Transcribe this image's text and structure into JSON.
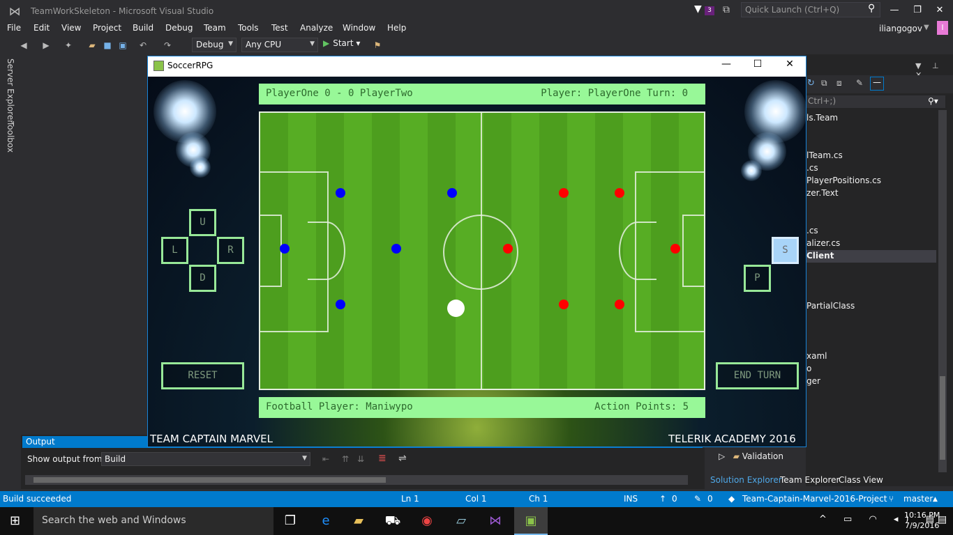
{
  "window": {
    "title": "TeamWorkSkeleton - Microsoft Visual Studio",
    "notification_count": "3",
    "quick_launch_placeholder": "Quick Launch (Ctrl+Q)",
    "username": "iliangogov",
    "user_initial": "I"
  },
  "menu": [
    "File",
    "Edit",
    "View",
    "Project",
    "Build",
    "Debug",
    "Team",
    "Tools",
    "Test",
    "Analyze",
    "Window",
    "Help"
  ],
  "toolbar": {
    "config": "Debug",
    "platform": "Any CPU",
    "start_label": "Start"
  },
  "left_tabs": [
    "Server Explorer",
    "Toolbox"
  ],
  "solution_explorer": {
    "search_placeholder": "Ctrl+;)",
    "items": [
      "ls.Team",
      "lTeam.cs",
      ".cs",
      "PlayerPositions.cs",
      "zer.Text",
      ".cs",
      "alizer.cs",
      "Client",
      "PartialClass",
      "xaml",
      "o",
      "ger"
    ],
    "selected": "Client",
    "validation": "Validation",
    "tabs": [
      "Solution Explorer",
      "Team Explorer",
      "Class View"
    ]
  },
  "output": {
    "tab": "Output",
    "show_from_label": "Show output from:",
    "source": "Build"
  },
  "status": {
    "message": "Build succeeded",
    "line": "Ln 1",
    "col": "Col 1",
    "ch": "Ch 1",
    "mode": "INS",
    "up": "0",
    "edits": "0",
    "repo": "Team-Captain-Marvel-2016-Project",
    "branch": "master"
  },
  "taskbar": {
    "search": "Search the web and Windows",
    "time": "10:16 PM",
    "date": "7/9/2016"
  },
  "game": {
    "title": "SoccerRPG",
    "score": "PlayerOne  0 - 0  PlayerTwo",
    "turn": "Player: PlayerOne Turn: 0",
    "football_player": "Football Player: Maniwypo",
    "action_points": "Action Points: 5",
    "btn_up": "U",
    "btn_left": "L",
    "btn_right": "R",
    "btn_down": "D",
    "btn_s": "S",
    "btn_p": "P",
    "reset": "RESET",
    "end_turn": "END TURN",
    "footer_left": "TEAM CAPTAIN MARVEL",
    "footer_right": "TELERIK ACADEMY 2016"
  },
  "colors": {
    "vs_accent": "#007acc",
    "team_one": "#0000ff",
    "team_two": "#ff0000",
    "info_bar": "#98f898"
  }
}
